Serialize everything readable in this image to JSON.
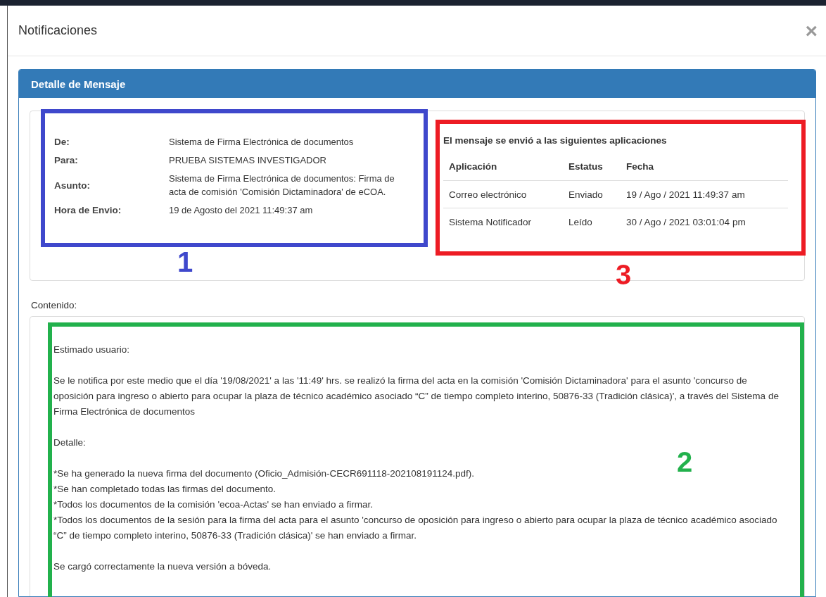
{
  "modal": {
    "title": "Notificaciones",
    "close": "×"
  },
  "panel": {
    "title": "Detalle de Mensaje",
    "fields": [
      {
        "label": "De:",
        "value": "Sistema de Firma Electrónica de documentos"
      },
      {
        "label": "Para:",
        "value": "PRUEBA SISTEMAS INVESTIGADOR"
      },
      {
        "label": "Asunto:",
        "value": "Sistema de Firma Electrónica de documentos: Firma de acta de comisión 'Comisión Dictaminadora' de eCOA."
      },
      {
        "label": "Hora de Envio:",
        "value": "19 de Agosto del 2021 11:49:37 am"
      }
    ],
    "delivery": {
      "heading": "El mensaje se envió a las siguientes aplicaciones",
      "columns": [
        "Aplicación",
        "Estatus",
        "Fecha"
      ],
      "rows": [
        [
          "Correo electrónico",
          "Enviado",
          "19 / Ago / 2021 11:49:37 am"
        ],
        [
          "Sistema Notificador",
          "Leído",
          "30 / Ago / 2021 03:01:04 pm"
        ]
      ]
    },
    "content_label": "Contenido:",
    "content": [
      "Estimado usuario:",
      "Se le notifica por este medio que el día '19/08/2021' a las '11:49' hrs. se realizó la firma del acta en la comisión 'Comisión Dictaminadora' para el asunto 'concurso de oposición para ingreso o abierto para ocupar la plaza de técnico académico asociado “C” de tiempo completo interino, 50876-33 (Tradición clásica)', a través del Sistema de Firma Electrónica de documentos",
      "Detalle:",
      [
        "*Se ha generado la nueva firma del documento (Oficio_Admisión-CECR691118-202108191124.pdf).",
        "*Se han completado todas las firmas del documento.",
        "*Todos los documentos de la comisión 'ecoa-Actas' se han enviado a firmar.",
        "*Todos los documentos de la sesión para la firma del acta para el asunto 'concurso de oposición para ingreso o abierto para ocupar la plaza de técnico académico asociado “C” de tiempo completo interino, 50876-33 (Tradición clásica)' se han enviado a firmar."
      ],
      "Se cargó correctamente la nueva versión a bóveda."
    ]
  },
  "annotations": [
    {
      "label": "1",
      "color": "#3f48cc"
    },
    {
      "label": "2",
      "color": "#22b14c"
    },
    {
      "label": "3",
      "color": "#ed1c24"
    }
  ]
}
